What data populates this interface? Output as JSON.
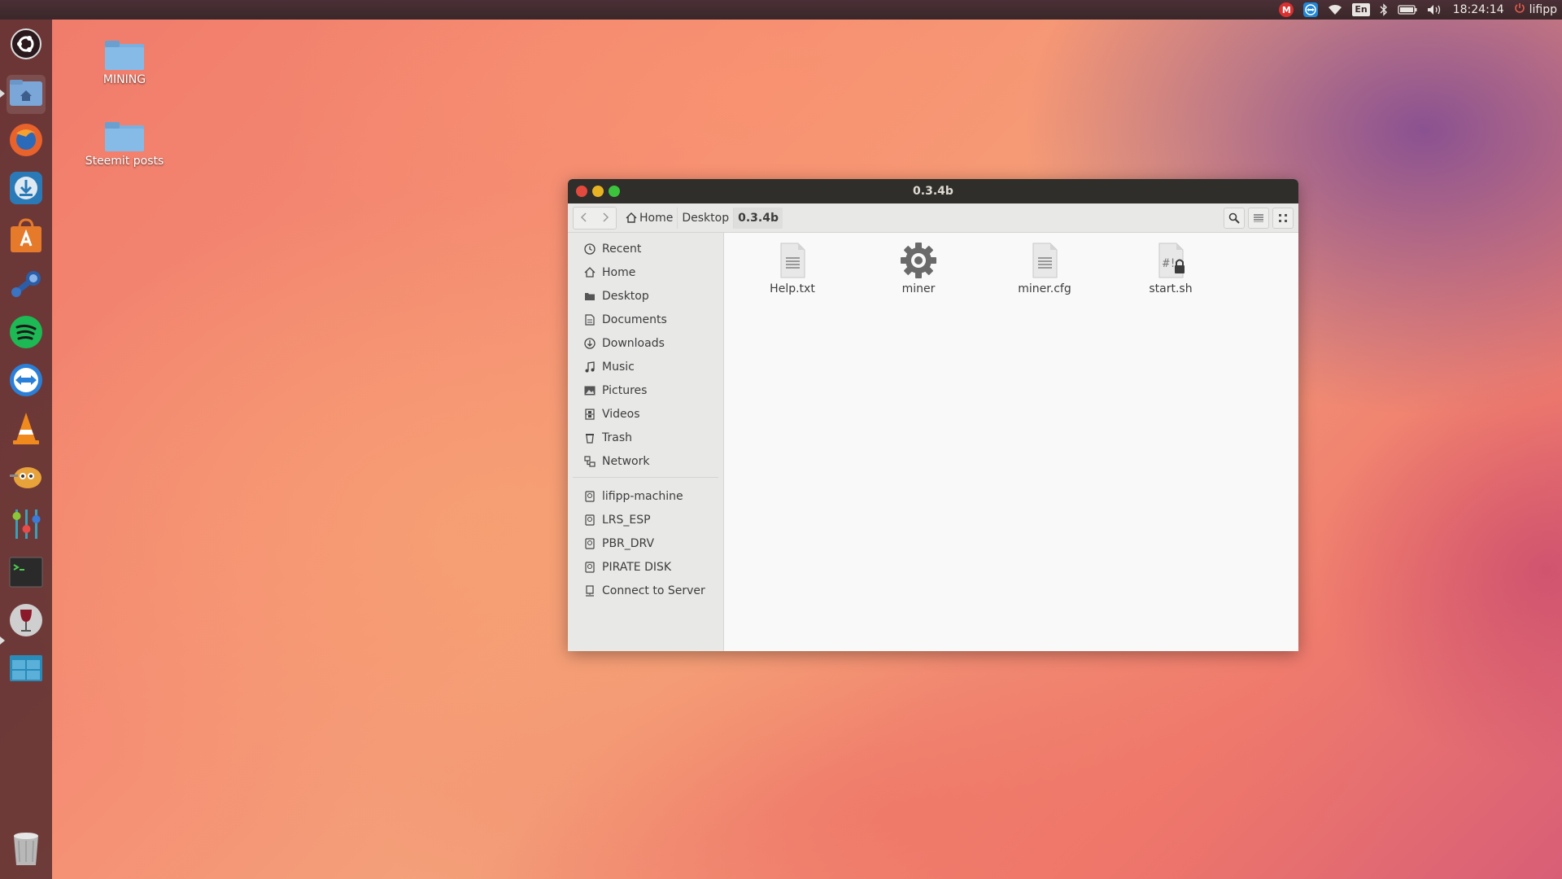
{
  "top_panel": {
    "mail_badge": "M",
    "keyboard_layout": "En",
    "clock": "18:24:14",
    "user": "lifipp",
    "icons": [
      "mail-indicator-icon",
      "teamviewer-tray-icon",
      "wifi-icon",
      "keyboard-layout-icon",
      "bluetooth-icon",
      "battery-icon",
      "volume-icon",
      "power-icon"
    ]
  },
  "launcher": {
    "items": [
      {
        "name": "ubuntu-dash",
        "color": "#dddddd"
      },
      {
        "name": "files",
        "color": "#7aa6d8"
      },
      {
        "name": "firefox",
        "color": "#e8622c"
      },
      {
        "name": "transmission",
        "color": "#2a7ab8"
      },
      {
        "name": "software-center",
        "color": "#e67a2b"
      },
      {
        "name": "steam",
        "color": "#2b5ea8"
      },
      {
        "name": "spotify",
        "color": "#1db954"
      },
      {
        "name": "teamviewer",
        "color": "#2a80d8"
      },
      {
        "name": "vlc",
        "color": "#f08a1c"
      },
      {
        "name": "gimp",
        "color": "#e8a23a"
      },
      {
        "name": "settings",
        "color": "#3aa0b8"
      },
      {
        "name": "terminal",
        "color": "#2a2a2a"
      },
      {
        "name": "wine",
        "color": "#ccccccc"
      },
      {
        "name": "workspaces",
        "color": "#2a8ab8"
      }
    ],
    "trash": "trash"
  },
  "desktop": {
    "icons": [
      {
        "label": "MINING"
      },
      {
        "label": "Steemit posts"
      }
    ]
  },
  "window": {
    "title": "0.3.4b",
    "breadcrumbs": [
      "Home",
      "Desktop",
      "0.3.4b"
    ],
    "sidebar": {
      "places": [
        "Recent",
        "Home",
        "Desktop",
        "Documents",
        "Downloads",
        "Music",
        "Pictures",
        "Videos",
        "Trash",
        "Network"
      ],
      "devices": [
        "lifipp-machine",
        "LRS_ESP",
        "PBR_DRV",
        "PIRATE DISK",
        "Connect to Server"
      ]
    },
    "files": [
      {
        "name": "Help.txt",
        "icon": "text-file-icon"
      },
      {
        "name": "miner",
        "icon": "executable-gear-icon"
      },
      {
        "name": "miner.cfg",
        "icon": "text-file-icon"
      },
      {
        "name": "start.sh",
        "icon": "script-locked-icon"
      }
    ]
  }
}
